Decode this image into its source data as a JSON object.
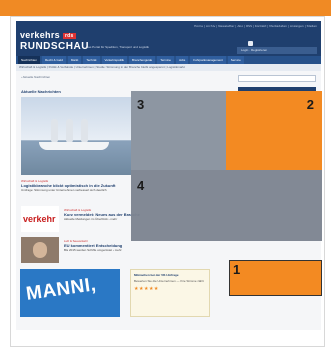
{
  "site": {
    "logo_line1": "verkehrs",
    "logo_tag": "rds",
    "logo_line2": "RUNDSCHAU",
    "tagline": "Das Portal für Spedition, Transport und Logistik",
    "toplinks": "Home | Archiv | Newsletter | Abo | RSS | Kontakt | Mediadaten | Anzeigen | Stellen",
    "login_text": "Login · Registrieren",
    "nav": [
      "Nachrichten",
      "Recht & Geld",
      "Markt",
      "Technik",
      "Verkehrspolitik",
      "Branchenguide",
      "Termine",
      "Jobs",
      "Fuhrparkmanagement",
      "Service"
    ],
    "subnav": "Wirtschaft & Logistik | Politik & Verbände | Unternehmen | Studie: Stimmung in der Branche bleibt angespannt | Logistikmarkt",
    "breadcrumb": "› Aktuelle Nachrichten",
    "section_title": "Aktuelle Nachrichten",
    "stories": [
      {
        "kicker": "Wirtschaft & Logistik",
        "title": "Logistikbranche blickt optimistisch in die Zukunft",
        "text": "Umfrage: Stimmung unter Unternehmen verbessert sich deutlich"
      },
      {
        "kicker": "Wirtschaft & Logistik",
        "title": "Kurz vermeldet: Neues aus der Branche",
        "text": "Aktuelle Meldungen im Überblick › mehr"
      },
      {
        "kicker": "Luft & Seeverkehr",
        "title": "EU kommentiert Entscheidung",
        "text": "Bis 2015 werden Schiffe umgerüstet › mehr"
      }
    ],
    "thumb_word": "verkehr",
    "banner_text": "MANNI,",
    "ad": {
      "title": "Mitmachen bei der VR-Umfrage",
      "text": "Bewerten Sie die Unternehmen — Ihre Stimme zählt",
      "stars": "★★★★★"
    }
  },
  "overlay": {
    "zones": [
      {
        "id": "1",
        "label": "1",
        "color": "#f38a22"
      },
      {
        "id": "2",
        "label": "2",
        "color": "#f38a22"
      },
      {
        "id": "3",
        "label": "3",
        "color": "#848e9b"
      },
      {
        "id": "4",
        "label": "4",
        "color": "#7b838f"
      }
    ]
  },
  "colors": {
    "accent": "#f08a24",
    "brand": "#1f3f6e"
  }
}
